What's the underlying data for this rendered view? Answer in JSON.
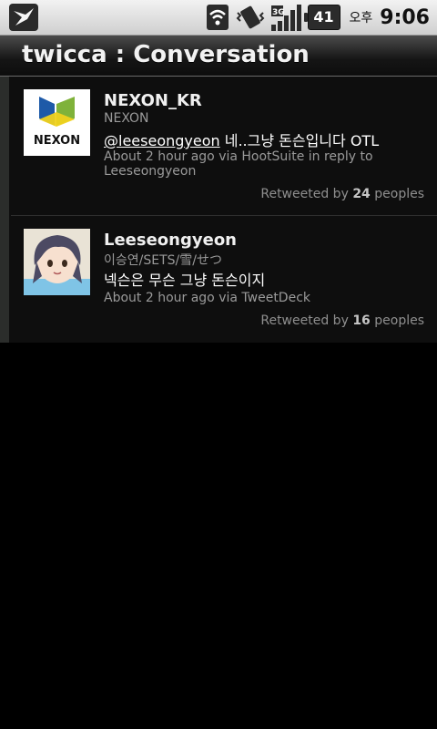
{
  "status_bar": {
    "battery_level": "41",
    "ampm": "오후",
    "time": "9:06",
    "network": "3G",
    "icons": [
      "twicca-notification-icon",
      "wifi-icon",
      "vibrate-icon",
      "signal-3g-icon",
      "battery-icon"
    ]
  },
  "title_bar": {
    "title": "twicca : Conversation"
  },
  "tweets": [
    {
      "screen_name": "NEXON_KR",
      "full_name": "NEXON",
      "mention": "@leeseongyeon",
      "text": " 네..그냥 돈슨입니다 OTL",
      "meta": "About 2 hour ago via HootSuite in reply to Leeseongyeon",
      "retweet_prefix": "Retweeted by ",
      "retweet_count": "24",
      "retweet_suffix": " peoples",
      "avatar_text": "NEXON"
    },
    {
      "screen_name": "Leeseongyeon",
      "full_name": "이승연/SETS/雪/せつ",
      "text": "넥슨은 무슨 그냥 돈슨이지",
      "meta": "About 2 hour ago via TweetDeck",
      "retweet_prefix": "Retweeted by ",
      "retweet_count": "16",
      "retweet_suffix": " peoples"
    }
  ],
  "colors": {
    "accent_blue": "#1e5aa8",
    "accent_green": "#7fb23a",
    "accent_yellow": "#f0d21e"
  }
}
